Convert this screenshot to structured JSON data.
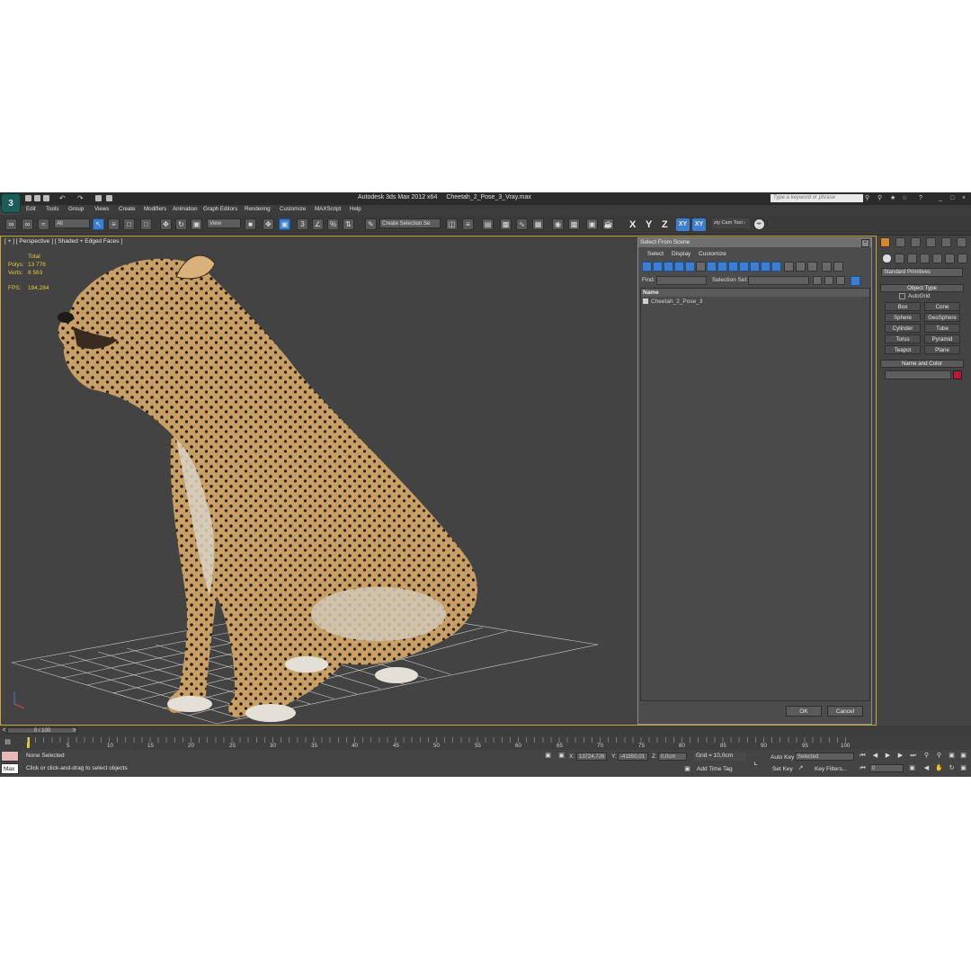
{
  "app": {
    "title": "Autodesk 3ds Max  2012 x64",
    "file": "Cheetah_2_Pose_3_Vray.max",
    "search_placeholder": "Type a keyword or phrase",
    "logo_glyph": "3"
  },
  "menu": [
    "Edit",
    "Tools",
    "Group",
    "Views",
    "Create",
    "Modifiers",
    "Animation",
    "Graph Editors",
    "Rendering",
    "Customize",
    "MAXScript",
    "Help"
  ],
  "toolbar": {
    "filter": "All",
    "ref_coord": "View",
    "selection_set": "Create Selection Se",
    "axis_x": "X",
    "axis_y": "Y",
    "axis_z": "Z",
    "axis_xy": "XY",
    "axis_xy2": "XY",
    "cam_tool": "zty Cam Tool ‹"
  },
  "viewport": {
    "label": "[ + ] [ Perspective ] [ Shaded + Edged Faces ]",
    "stats_total_label": "Total",
    "polys_label": "Polys:",
    "polys_value": "13 776",
    "verts_label": "Verts:",
    "verts_value": "8 563",
    "fps_label": "FPS:",
    "fps_value": "194,284",
    "accent_color": "#c8aa3a"
  },
  "select_dialog": {
    "title": "Select From Scene",
    "menu": [
      "Select",
      "Display",
      "Customize"
    ],
    "find_label": "Find:",
    "selection_set_label": "Selection Set:",
    "column_name": "Name",
    "items": [
      "Cheetah_2_Pose_3"
    ],
    "ok": "OK",
    "cancel": "Cancel"
  },
  "command_panel": {
    "category": "Standard Primitives",
    "object_type": "Object Type",
    "autogrid": "AutoGrid",
    "buttons": [
      "Box",
      "Cone",
      "Sphere",
      "GeoSphere",
      "Cylinder",
      "Tube",
      "Torus",
      "Pyramid",
      "Teapot",
      "Plane"
    ],
    "name_and_color": "Name and Color",
    "object_color": "#c0143c"
  },
  "timeline": {
    "frame": "0 / 100",
    "ticks": [
      "5",
      "10",
      "15",
      "20",
      "25",
      "30",
      "35",
      "40",
      "45",
      "50",
      "55",
      "60",
      "65",
      "70",
      "75",
      "80",
      "85",
      "90",
      "95",
      "100"
    ],
    "zero": "0"
  },
  "status": {
    "selection": "None Selected",
    "prompt": "Click or click-and-drag to select objects",
    "max_label": "Max",
    "x_label": "X:",
    "x_value": "13724,726",
    "y_label": "Y:",
    "y_value": "-41550,01",
    "z_label": "Z:",
    "z_value": "0,0cm",
    "grid": "Grid = 10,0cm",
    "add_time_tag": "Add Time Tag",
    "auto_key": "Auto Key",
    "set_key": "Set Key",
    "key_mode": "Selected",
    "key_filters": "Key Filters...",
    "current_frame": "0"
  }
}
